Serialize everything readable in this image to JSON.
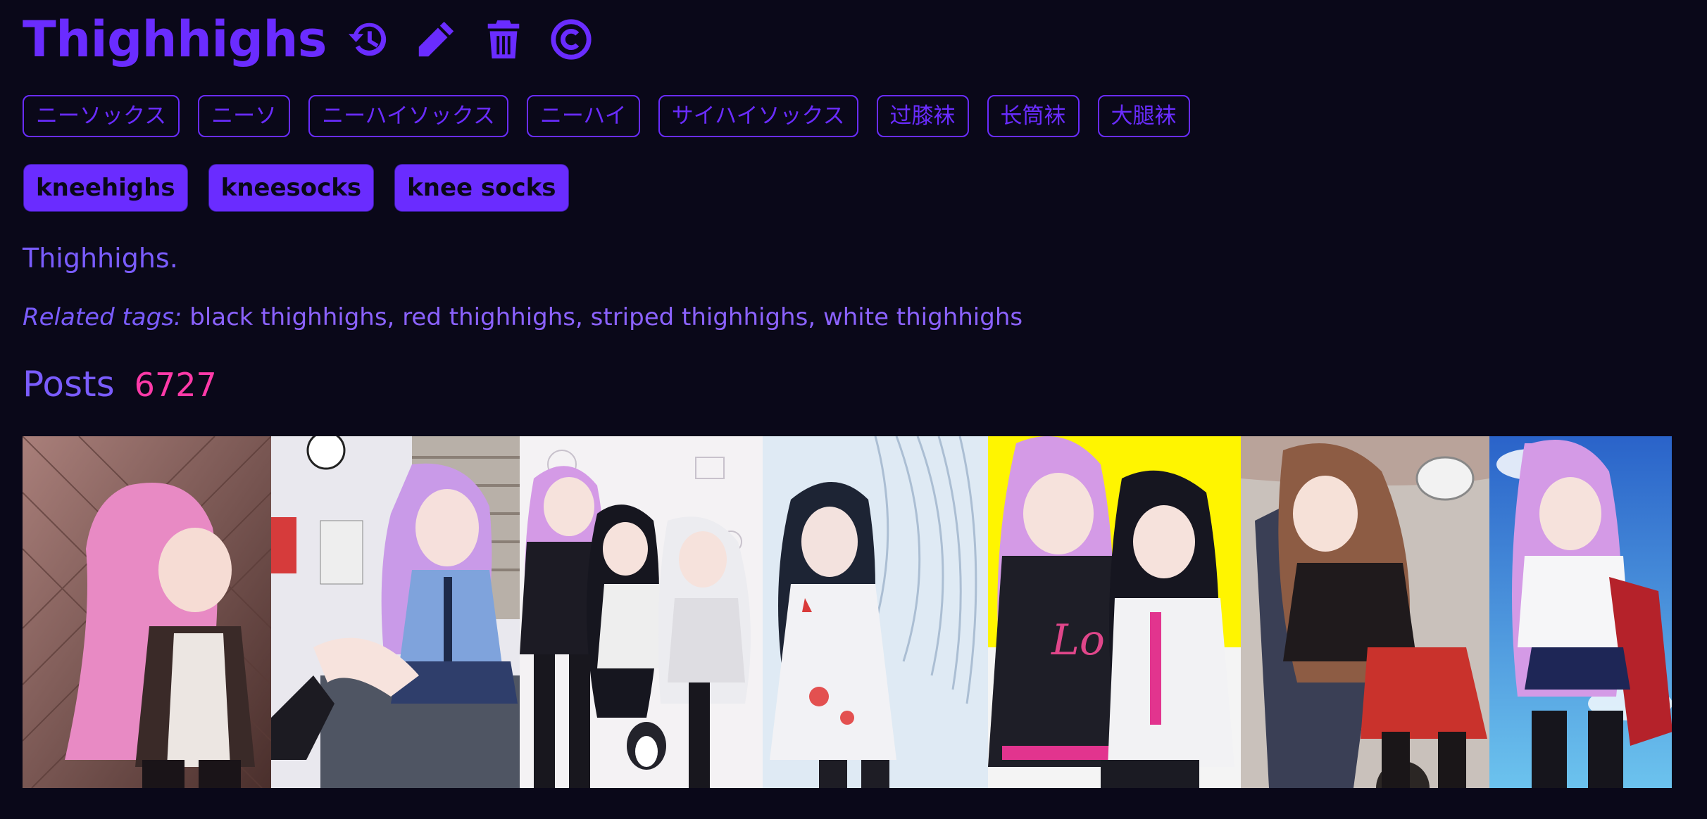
{
  "tag": {
    "title": "Thighhighs",
    "description": "Thighhighs.",
    "other_names": [
      "ニーソックス",
      "ニーソ",
      "ニーハイソックス",
      "ニーハイ",
      "サイハイソックス",
      "过膝袜",
      "长筒袜",
      "大腿袜"
    ],
    "aliases": [
      "kneehighs",
      "kneesocks",
      "knee socks"
    ]
  },
  "icons": {
    "history": "history-icon",
    "edit": "pencil-icon",
    "delete": "trash-icon",
    "copyright": "copyright-icon"
  },
  "related": {
    "label": "Related tags:",
    "tags": [
      "black thighhighs,",
      "red thighhighs,",
      "striped thighhighs,",
      "white thighhighs"
    ]
  },
  "posts": {
    "heading": "Posts",
    "count": "6727"
  },
  "thumbnails": [
    {
      "subject": "pink-haired girl at chain-link fence"
    },
    {
      "subject": "pink-haired girl sitting on desk in office"
    },
    {
      "subject": "three girls with hoodies on sketch background"
    },
    {
      "subject": "black-haired girl in white hoodie"
    },
    {
      "subject": "two girls in hoodies on yellow background"
    },
    {
      "subject": "brown-haired girl lying down"
    },
    {
      "subject": "pink-haired girl in gym uniform with sky"
    }
  ],
  "colors": {
    "background": "#0a0819",
    "accent": "#6a2cff",
    "text": "#7a5cff",
    "count": "#ff3aa8"
  }
}
